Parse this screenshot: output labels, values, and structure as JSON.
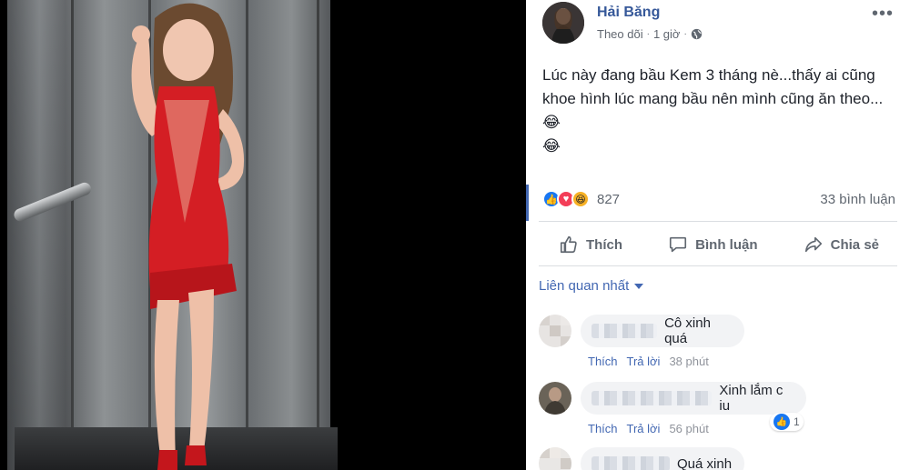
{
  "post": {
    "author": "Hải Băng",
    "follow_label": "Theo dõi",
    "separator": "·",
    "time": "1 giờ",
    "more_label": "•••",
    "text_line1": "Lúc này đang bầu Kem 3 tháng nè...thấy ai cũng",
    "text_line2": "khoe hình lúc mang bầu nên mình cũng ăn theo...😂",
    "text_line3": "😂"
  },
  "stats": {
    "reaction_count": "827",
    "comment_count": "33 bình luận",
    "reactions": [
      "like",
      "love",
      "haha"
    ]
  },
  "actions": {
    "like_label": "Thích",
    "comment_label": "Bình luận",
    "share_label": "Chia sẻ"
  },
  "comments_sort": {
    "label": "Liên quan nhất"
  },
  "comments": [
    {
      "text": "Cô xinh quá",
      "like_label": "Thích",
      "reply_label": "Trả lời",
      "time": "38 phút"
    },
    {
      "text": "Xinh lắm c iu",
      "like_label": "Thích",
      "reply_label": "Trả lời",
      "time": "56 phút",
      "likes": "1"
    },
    {
      "text": "Quá xinh"
    }
  ],
  "colors": {
    "link_blue": "#4267b2",
    "author_blue": "#365899",
    "like_blue": "#1877f2",
    "love_red": "#f33e58",
    "haha_yellow": "#f7b125"
  }
}
